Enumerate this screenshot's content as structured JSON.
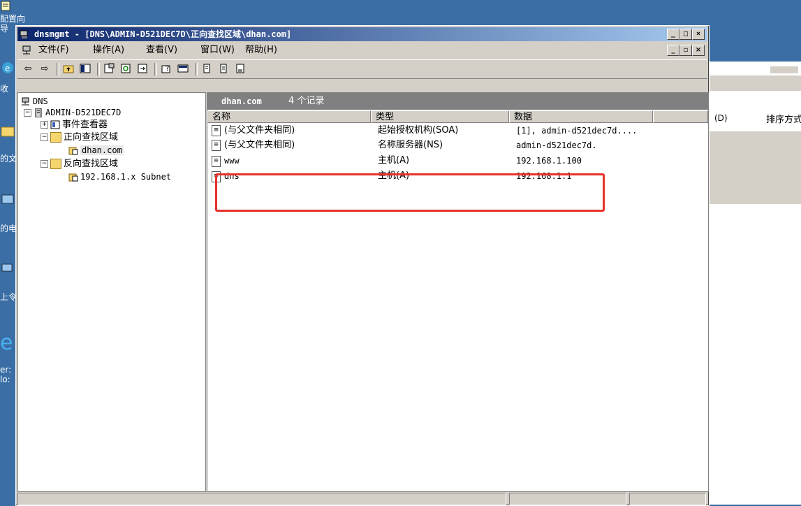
{
  "desktop": {
    "labels": [
      "配置向",
      "导",
      "收",
      "的文",
      "的电",
      "上令",
      "er:",
      "lo:"
    ]
  },
  "background_window": {
    "col_fragment": "(D)",
    "sort_label": "排序方式"
  },
  "window": {
    "title": "dnsmgmt - [DNS\\ADMIN-D521DEC7D\\正向查找区域\\dhan.com]",
    "menu": [
      "文件(F)",
      "操作(A)",
      "查看(V)",
      "窗口(W)",
      "帮助(H)"
    ]
  },
  "tree": {
    "root": "DNS",
    "server": "ADMIN-D521DEC7D",
    "event_viewer": "事件查看器",
    "forward_zones": "正向查找区域",
    "forward_zone_item": "dhan.com",
    "reverse_zones": "反向查找区域",
    "reverse_zone_item": "192.168.1.x Subnet"
  },
  "list": {
    "zone_name": "dhan.com",
    "record_count": "4 个记录",
    "columns": [
      "名称",
      "类型",
      "数据"
    ],
    "rows": [
      {
        "name": "(与父文件夹相同)",
        "type": "起始授权机构(SOA)",
        "data": "[1], admin-d521dec7d...."
      },
      {
        "name": "(与父文件夹相同)",
        "type": "名称服务器(NS)",
        "data": "admin-d521dec7d."
      },
      {
        "name": "www",
        "type": "主机(A)",
        "data": "192.168.1.100"
      },
      {
        "name": "dns",
        "type": "主机(A)",
        "data": "192.168.1.1"
      }
    ]
  },
  "colors": {
    "desktop": "#3a6ea5",
    "title_gradient_start": "#0a246a",
    "title_gradient_end": "#a6caf0",
    "highlight": "#e8312a"
  }
}
